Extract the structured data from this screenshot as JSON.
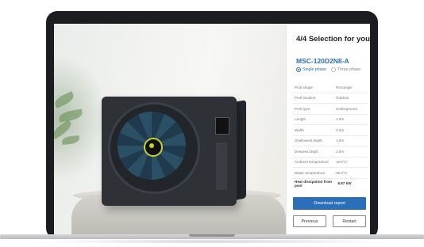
{
  "panel": {
    "title": "4/4 Selection for you",
    "model": "MSC-120D2N8-A",
    "phase_options": [
      {
        "label": "Single phase",
        "selected": true
      },
      {
        "label": "Three phase",
        "selected": false
      }
    ],
    "specs": [
      {
        "label": "Pool shape",
        "value": "Rectangle"
      },
      {
        "label": "Pool location",
        "value": "Outdoor"
      },
      {
        "label": "Pool type",
        "value": "Underground"
      },
      {
        "label": "Length",
        "value": "4.0m"
      },
      {
        "label": "Width",
        "value": "3.0m"
      },
      {
        "label": "Shallowest depth",
        "value": "1.0m"
      },
      {
        "label": "Deepest depth",
        "value": "2.0m"
      },
      {
        "label": "Ambient temperature",
        "value": "10.0°C"
      },
      {
        "label": "Water temperature",
        "value": "25.0°C"
      },
      {
        "label": "Heat dissipation from pool",
        "value": "8.87 kW"
      }
    ],
    "download_label": "Download report",
    "previous_label": "Previous",
    "restart_label": "Restart"
  },
  "colors": {
    "accent": "#2a6fb8",
    "laptop_frame": "#1c1d20",
    "unit_body": "#2e3136",
    "logo_accent": "#c8d22b"
  }
}
